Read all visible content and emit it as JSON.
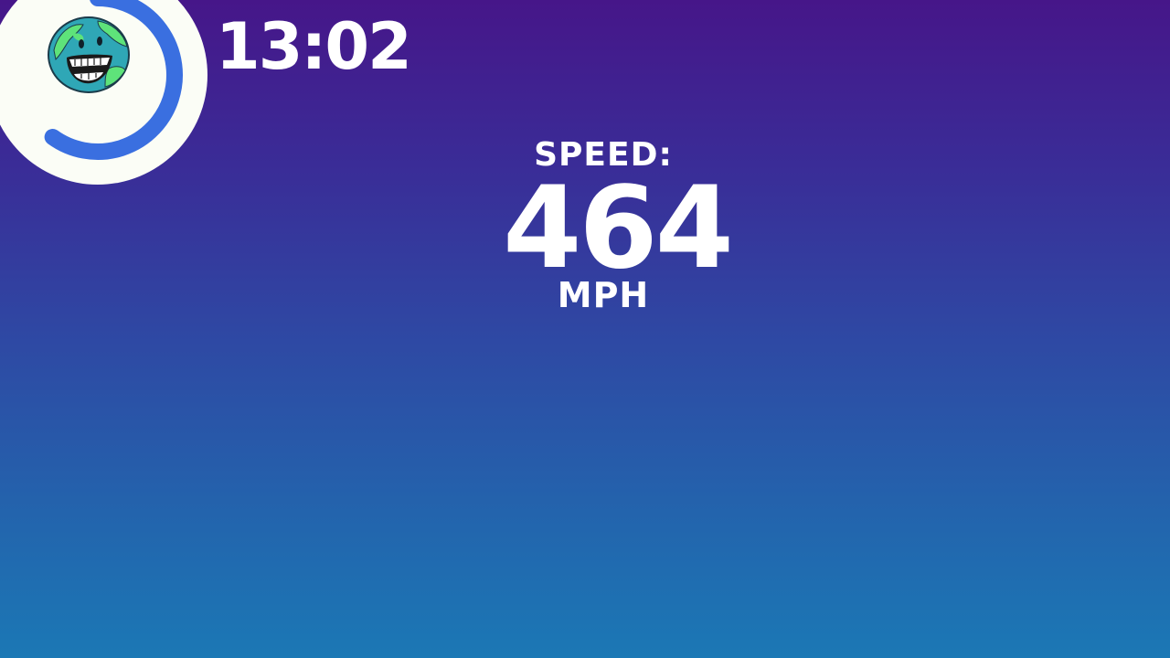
{
  "hud": {
    "clock": "13:02",
    "avatar_icon": "earth-mascot-icon",
    "progress_fraction": 0.6,
    "progress_color": "#3a6fe0",
    "badge_color": "#fbfdf6"
  },
  "speedometer": {
    "label": "SPEED:",
    "value": "464",
    "unit": "MPH"
  },
  "colors": {
    "background_top": "#461689",
    "background_bottom": "#1b78b5",
    "text": "#ffffff"
  }
}
